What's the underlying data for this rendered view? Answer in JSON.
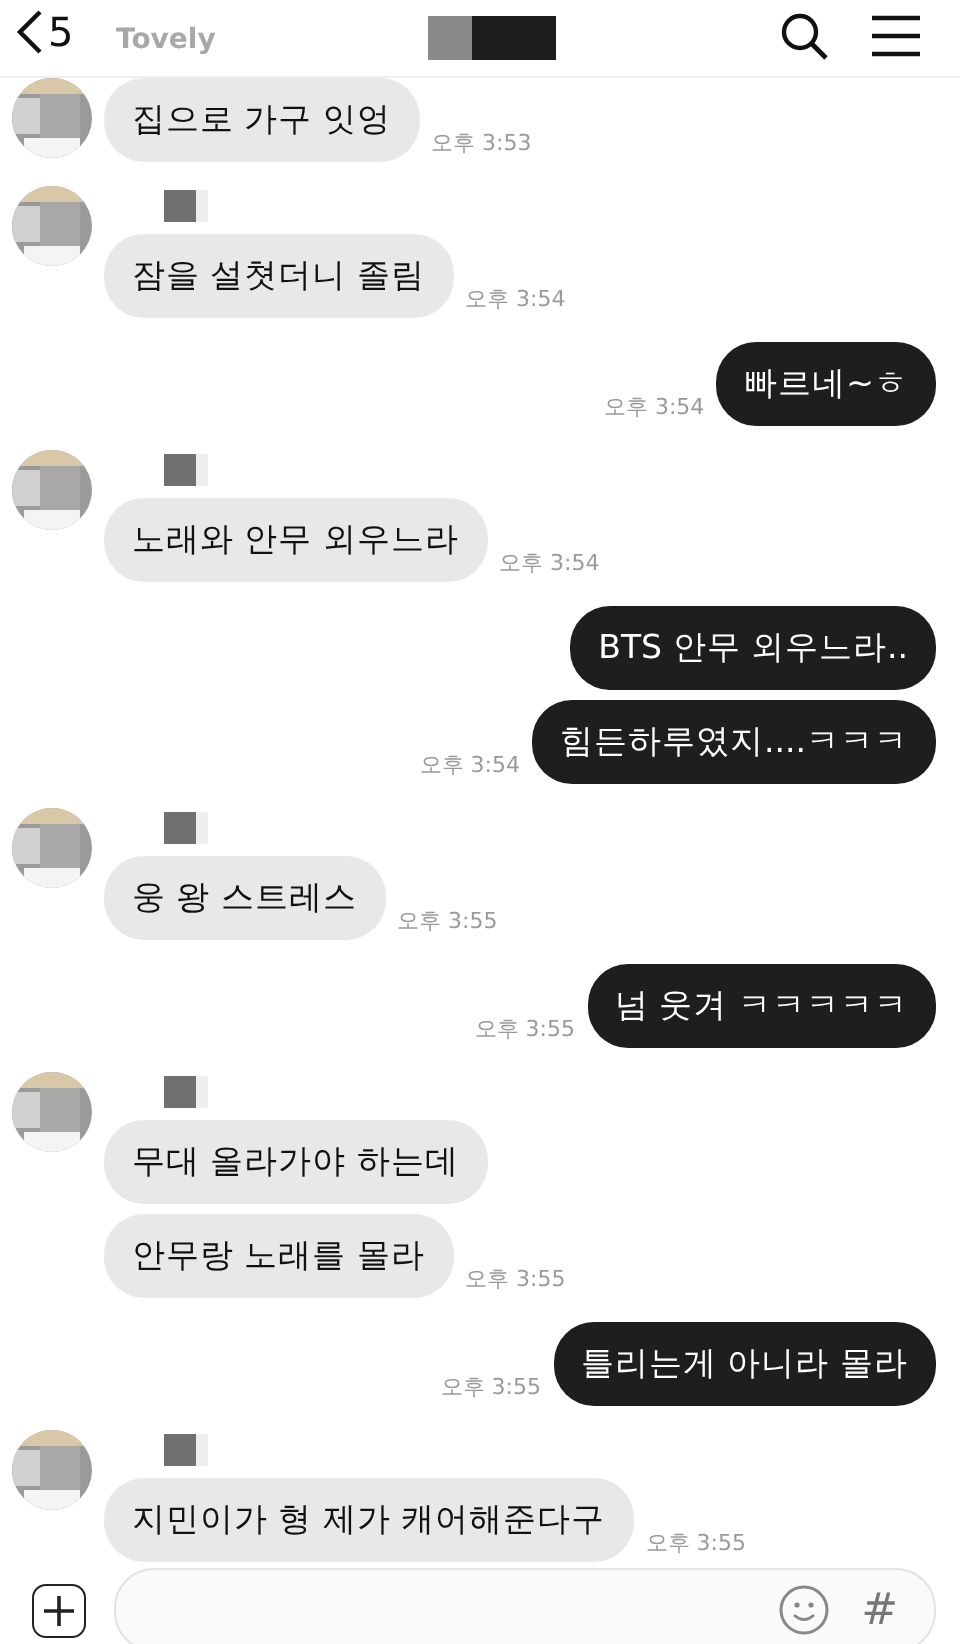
{
  "header": {
    "back_count": "5",
    "behind_name": "Tovely"
  },
  "groups": [
    {
      "kind": "received",
      "continued": true,
      "messages": [
        {
          "text": "집으로 가구 잇엉",
          "time": "오후 3:53"
        }
      ]
    },
    {
      "kind": "received",
      "continued": false,
      "messages": [
        {
          "text": "잠을 설쳣더니 졸림",
          "time": "오후 3:54"
        }
      ]
    },
    {
      "kind": "sent",
      "messages": [
        {
          "text": "빠르네~ㅎ",
          "time": "오후 3:54"
        }
      ]
    },
    {
      "kind": "received",
      "continued": false,
      "messages": [
        {
          "text": "노래와 안무 외우느라",
          "time": "오후 3:54"
        }
      ]
    },
    {
      "kind": "sent",
      "messages": [
        {
          "text": "BTS 안무 외우느라.."
        },
        {
          "text": "힘든하루였지....ㅋㅋㅋ",
          "time": "오후 3:54"
        }
      ]
    },
    {
      "kind": "received",
      "continued": false,
      "messages": [
        {
          "text": "웅 왕 스트레스",
          "time": "오후 3:55"
        }
      ]
    },
    {
      "kind": "sent",
      "messages": [
        {
          "text": "넘 웃겨 ㅋㅋㅋㅋㅋ",
          "time": "오후 3:55"
        }
      ]
    },
    {
      "kind": "received",
      "continued": false,
      "messages": [
        {
          "text": "무대 올라가야 하는데"
        },
        {
          "text": "안무랑 노래를 몰라",
          "time": "오후 3:55"
        }
      ]
    },
    {
      "kind": "sent",
      "messages": [
        {
          "text": "틀리는게 아니라 몰라",
          "time": "오후 3:55"
        }
      ]
    },
    {
      "kind": "received",
      "continued": false,
      "messages": [
        {
          "text": "지민이가 형 제가 캐어해준다구",
          "time": "오후 3:55"
        }
      ]
    }
  ],
  "composer": {
    "hash_key": "#"
  }
}
